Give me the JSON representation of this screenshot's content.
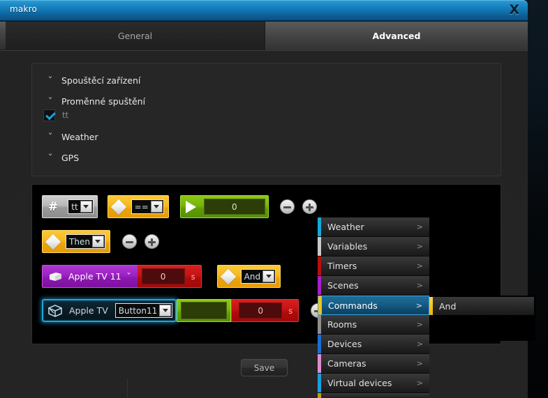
{
  "window": {
    "title": "makro",
    "close_label": "X"
  },
  "tabs": [
    {
      "label": "General",
      "active": false
    },
    {
      "label": "Advanced",
      "active": true
    }
  ],
  "triggers": {
    "rows": [
      {
        "label": "Spouštěcí zařízení",
        "chevron": "chevron-down-icon"
      },
      {
        "label": "Proměnné spuštění",
        "chevron": "chevron-down-icon"
      },
      {
        "label": "Weather",
        "chevron": "chevron-down-icon"
      },
      {
        "label": "GPS",
        "chevron": "chevron-down-icon"
      }
    ],
    "checked_item": {
      "label": "tt",
      "checked": true
    }
  },
  "macro": {
    "row1": {
      "var_icon": "hash-icon",
      "var_value": "tt",
      "operator_icon": "diamond-icon",
      "operator_value": "==",
      "action_icon": "play-icon",
      "action_value": "0",
      "minus_label": "minus-icon",
      "plus_label": "plus-icon"
    },
    "row2": {
      "operator_icon": "diamond-icon",
      "operator_value": "Then",
      "minus_label": "minus-icon",
      "plus_label": "plus-icon"
    },
    "row3": {
      "scene_icon": "scene-icon",
      "scene_label": "Apple TV 11",
      "scene_chevron": "chevron-down-icon",
      "delay_value": "0",
      "delay_unit": "s",
      "operator_icon": "diamond-icon",
      "operator_value": "And"
    },
    "row4": {
      "device_icon": "device-box-icon",
      "device_label": "Apple TV",
      "device_value": "Button11",
      "green_value": "",
      "delay_value": "0",
      "delay_unit": "s",
      "minus_label": "minus-icon"
    }
  },
  "footer": {
    "save_label": "Save"
  },
  "context_menu": {
    "items": [
      {
        "label": "Weather",
        "color": "#15a9d8",
        "arrow": ">",
        "selected": false
      },
      {
        "label": "Variables",
        "color": "#c9c9c9",
        "arrow": ">",
        "selected": false
      },
      {
        "label": "Timers",
        "color": "#bb0d0d",
        "arrow": ">",
        "selected": false
      },
      {
        "label": "Scenes",
        "color": "#a61fc9",
        "arrow": ">",
        "selected": false
      },
      {
        "label": "Commands",
        "color": "#f0c419",
        "arrow": ">",
        "selected": true
      },
      {
        "label": "Rooms",
        "color": "#8f8f8f",
        "arrow": ">",
        "selected": false
      },
      {
        "label": "Devices",
        "color": "#1a6fd4",
        "arrow": ">",
        "selected": false
      },
      {
        "label": "Cameras",
        "color": "#d98fd0",
        "arrow": ">",
        "selected": false
      },
      {
        "label": "Virtual devices",
        "color": "#1c9fd8",
        "arrow": ">",
        "selected": false
      },
      {
        "label": "",
        "color": "#c79a14",
        "arrow": "",
        "selected": false
      }
    ],
    "submenu": {
      "items": [
        {
          "label": "And",
          "color": "#f0c419"
        }
      ]
    }
  },
  "colors": {
    "accent_blue": "#1e8ec9",
    "highlight": "#1ea6e0",
    "orange": "#f7b91d",
    "green": "#76b508",
    "purple": "#9c22c2",
    "red": "#c41313"
  }
}
